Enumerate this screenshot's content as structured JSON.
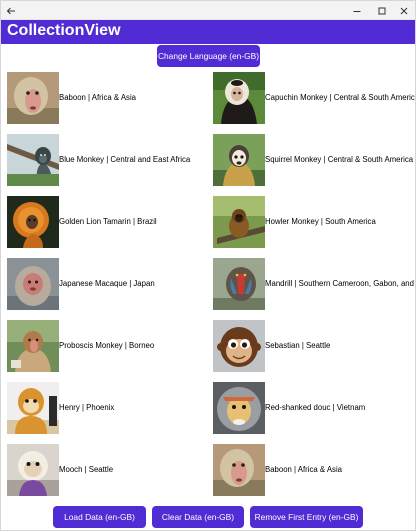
{
  "header": {
    "title": "CollectionView"
  },
  "toolbar": {
    "change_language_label": "Change Language (en-GB)",
    "load_data_label": "Load Data (en-GB)",
    "clear_data_label": "Clear Data (en-GB)",
    "remove_first_label": "Remove First Entry (en-GB)"
  },
  "monkeys": [
    {
      "label": "Baboon | Africa & Asia",
      "photo": "baboon"
    },
    {
      "label": "Capuchin Monkey | Central & South America",
      "photo": "capuchin"
    },
    {
      "label": "Blue Monkey | Central and East Africa",
      "photo": "blue-monkey"
    },
    {
      "label": "Squirrel Monkey | Central & South America",
      "photo": "squirrel-monkey"
    },
    {
      "label": "Golden Lion Tamarin | Brazil",
      "photo": "golden-lion-tamarin"
    },
    {
      "label": "Howler Monkey | South America",
      "photo": "howler-monkey"
    },
    {
      "label": "Japanese Macaque | Japan",
      "photo": "japanese-macaque"
    },
    {
      "label": "Mandrill | Southern Cameroon, Gabon, and",
      "photo": "mandrill"
    },
    {
      "label": "Proboscis Monkey | Borneo",
      "photo": "proboscis-monkey"
    },
    {
      "label": "Sebastian | Seattle",
      "photo": "sebastian"
    },
    {
      "label": "Henry | Phoenix",
      "photo": "henry"
    },
    {
      "label": "Red-shanked douc | Vietnam",
      "photo": "red-shanked-douc"
    },
    {
      "label": "Mooch | Seattle",
      "photo": "mooch"
    },
    {
      "label": "Baboon | Africa & Asia",
      "photo": "baboon"
    }
  ],
  "colors": {
    "accent": "#512bd4",
    "titlebar": "#f3f3f3"
  }
}
